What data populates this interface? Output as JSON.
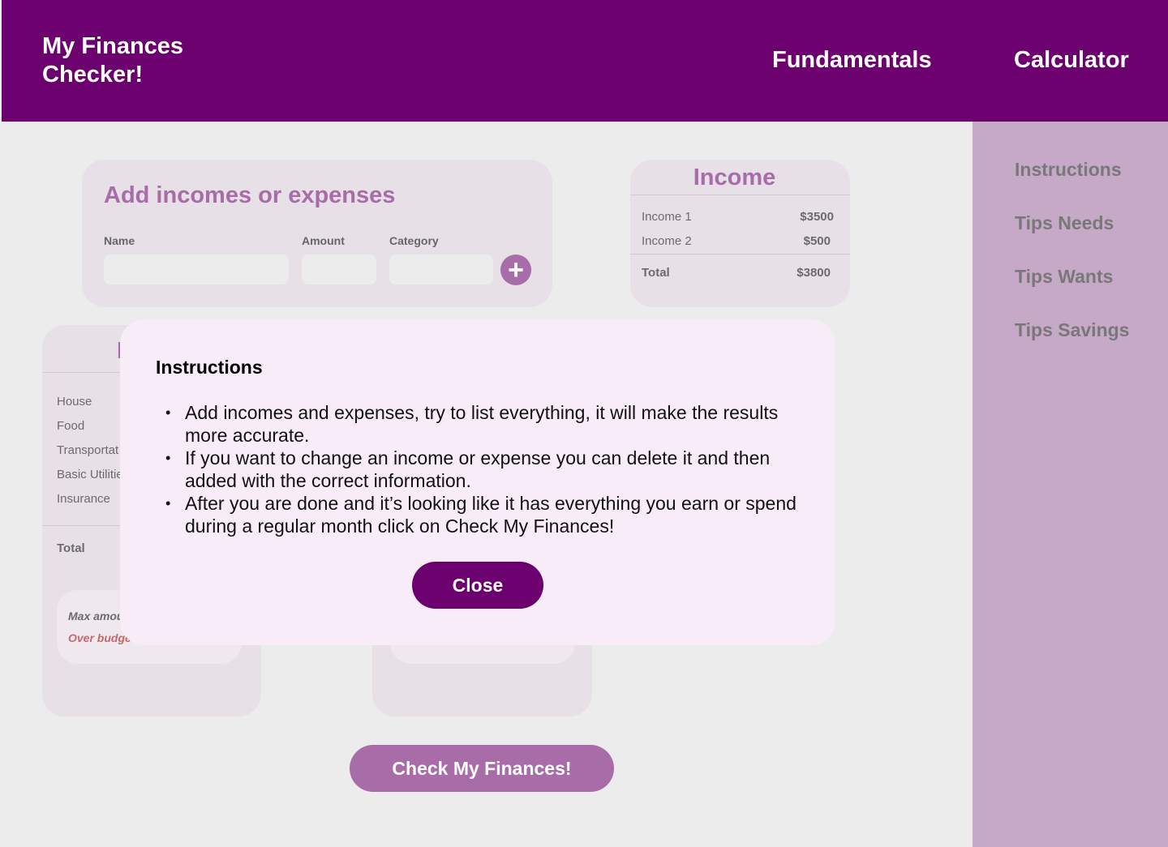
{
  "header": {
    "brand": "My Finances Checker!",
    "nav": [
      "Fundamentals",
      "Calculator"
    ]
  },
  "sidebar": {
    "items": [
      "Instructions",
      "Tips Needs",
      "Tips Wants",
      "Tips Savings"
    ]
  },
  "add_form": {
    "title": "Add incomes or expenses",
    "name_label": "Name",
    "amount_label": "Amount",
    "category_label": "Category",
    "name_value": "",
    "amount_value": "",
    "category_value": "",
    "add_icon": "plus-circle-icon"
  },
  "income": {
    "title": "Income",
    "rows": [
      {
        "name": "Income 1",
        "value": "$3500"
      },
      {
        "name": "Income 2",
        "value": "$500"
      }
    ],
    "total_label": "Total",
    "total_value": "$3800"
  },
  "expenses": {
    "title_partial": "N",
    "rows": [
      "House",
      "Food",
      "Transportat",
      "Basic Utilitie",
      "Insurance"
    ],
    "total_label": "Total",
    "max_label": "Max amou",
    "over_label": "Over budget"
  },
  "check_button": "Check My Finances!",
  "modal": {
    "title": "Instructions",
    "items": [
      "Add incomes and expenses, try to list everything, it will make the results more accurate.",
      "If you want to change an income or expense you can delete it and then added with the correct information.",
      "After you are done and it’s looking like it has everything you earn or spend during a regular month click on Check My Finances!"
    ],
    "close_label": "Close"
  },
  "colors": {
    "brand": "#6b006e",
    "accent": "#a86ca8",
    "sidebar": "#c5a9c7",
    "modal_bg": "#f8ecf8"
  }
}
